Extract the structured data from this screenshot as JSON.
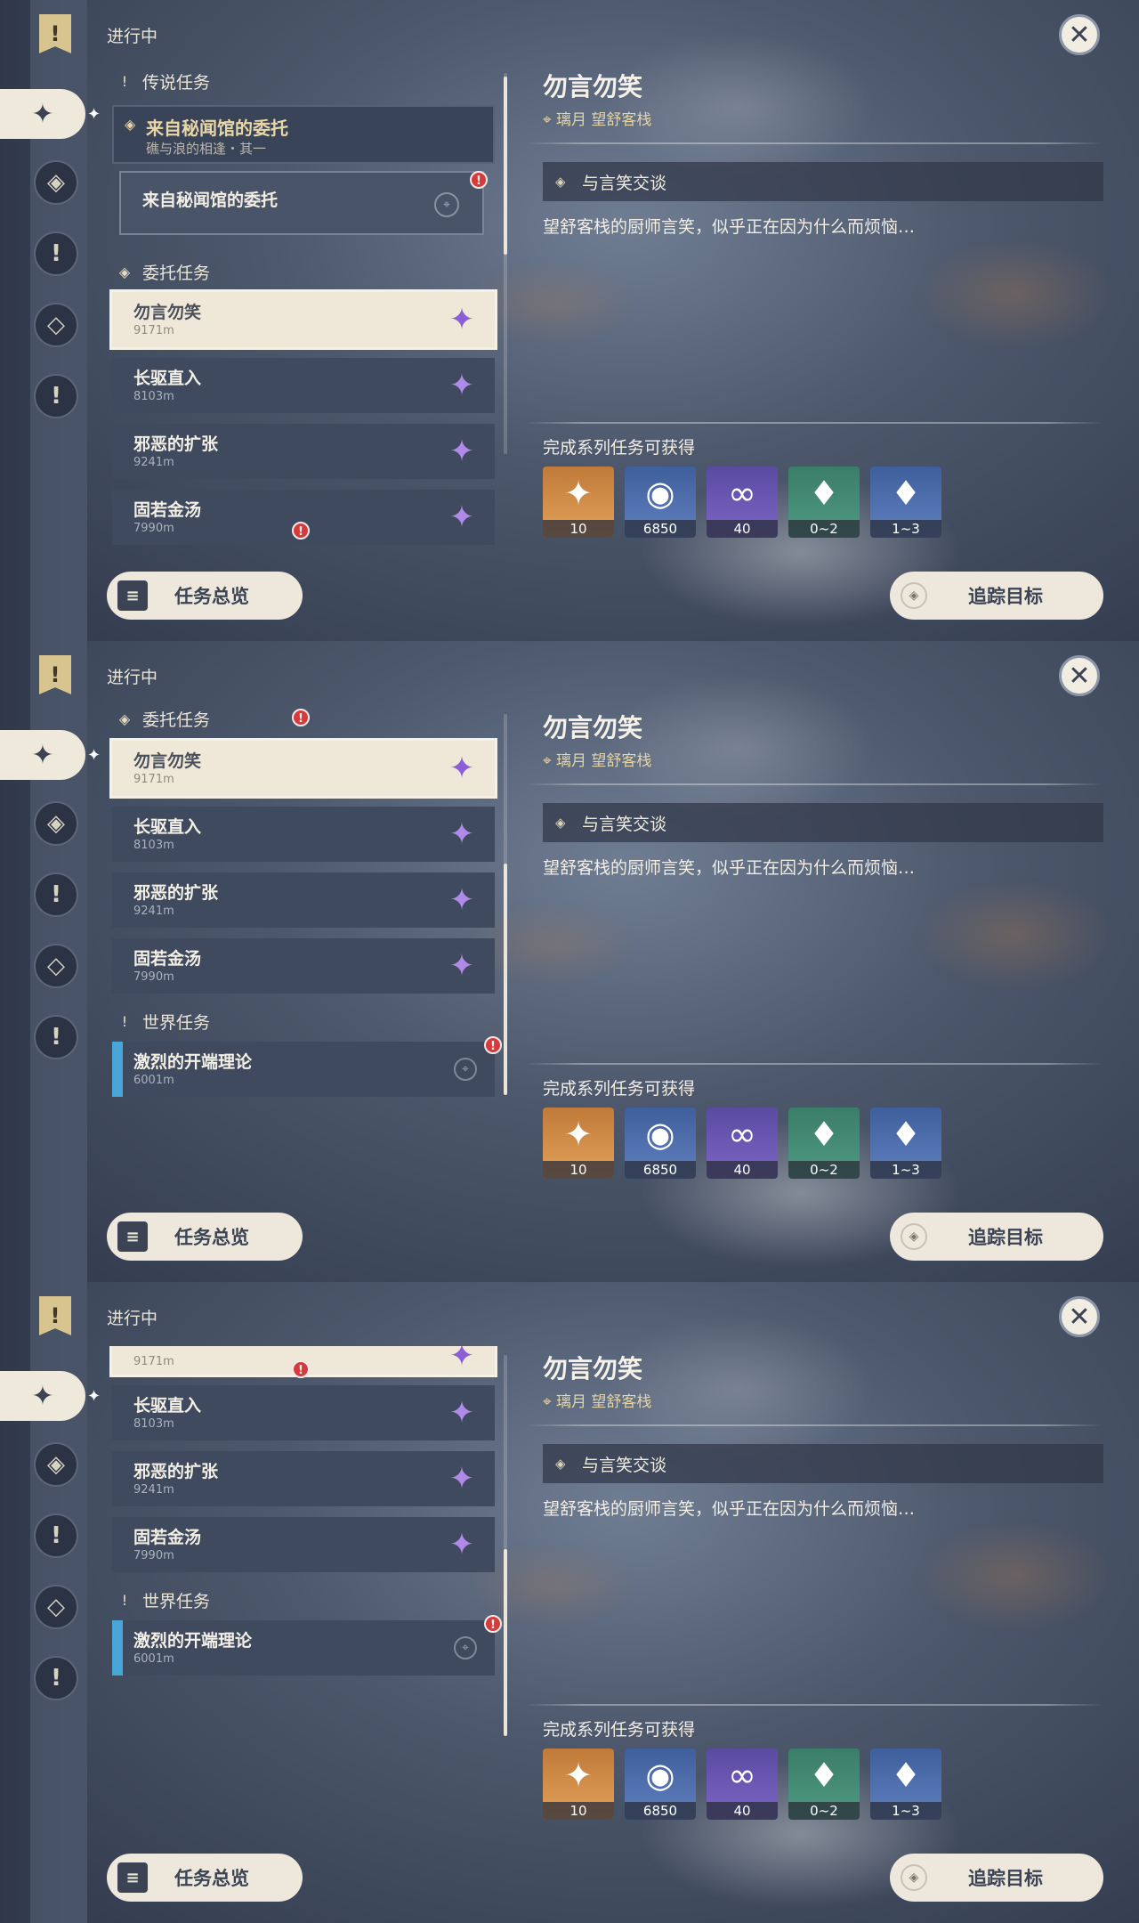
{
  "common": {
    "status_label": "进行中",
    "close_glyph": "✕",
    "nav_top_glyph": "!",
    "nav_active_glyph": "✦",
    "nav_icons": [
      "◈",
      "!",
      "◇",
      "!"
    ],
    "section_legend": "传说任务",
    "section_commission": "委托任务",
    "section_world": "世界任务",
    "legend_card_title": "来自秘闻馆的委托",
    "legend_card_subtitle": "礁与浪的相逢・其一",
    "legend_sub_title": "来自秘闻馆的委托",
    "detail_title": "勿言勿笑",
    "detail_location": "璃月 望舒客栈",
    "objective": "与言笑交谈",
    "description": "望舒客栈的厨师言笑，似乎正在因为什么而烦恼…",
    "reward_label": "完成系列任务可获得",
    "rewards": [
      {
        "icon": "✦",
        "count": "10",
        "color": "#e3a25a"
      },
      {
        "icon": "◉",
        "count": "6850",
        "color": "#5f7fbf"
      },
      {
        "icon": "∞",
        "count": "40",
        "color": "#7b67c6"
      },
      {
        "icon": "♦",
        "count": "0~2",
        "color": "#4f9a82"
      },
      {
        "icon": "♦",
        "count": "1~3",
        "color": "#5f7fbf"
      }
    ],
    "overview_button": "任务总览",
    "track_button": "追踪目标",
    "alert_glyph": "!",
    "gem_icon": "✦",
    "pin_icon": "⌖"
  },
  "commissions": [
    {
      "title": "勿言勿笑",
      "dist": "9171m"
    },
    {
      "title": "长驱直入",
      "dist": "8103m"
    },
    {
      "title": "邪恶的扩张",
      "dist": "9241m"
    },
    {
      "title": "固若金汤",
      "dist": "7990m"
    }
  ],
  "world_quests": [
    {
      "title": "激烈的开端理论",
      "dist": "6001m"
    }
  ]
}
